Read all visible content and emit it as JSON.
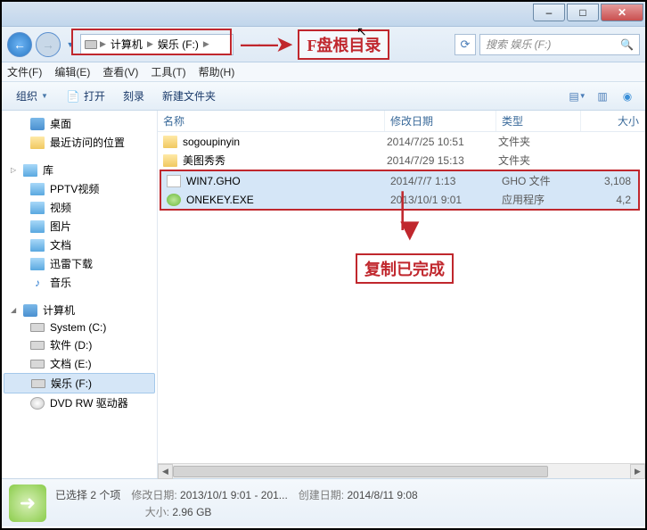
{
  "window": {
    "btn_min": "–",
    "btn_max": "□",
    "btn_close": "✕"
  },
  "address": {
    "computer": "计算机",
    "drive": "娱乐 (F:)",
    "annotation": "F盘根目录",
    "refresh": "⟳"
  },
  "search": {
    "placeholder": "搜索 娱乐 (F:)"
  },
  "menu": {
    "file": "文件(F)",
    "edit": "编辑(E)",
    "view": "查看(V)",
    "tools": "工具(T)",
    "help": "帮助(H)"
  },
  "toolbar": {
    "organize": "组织",
    "open": "打开",
    "burn": "刻录",
    "newfolder": "新建文件夹"
  },
  "nav": {
    "desktop": "桌面",
    "recent": "最近访问的位置",
    "library": "库",
    "pptv": "PPTV视频",
    "video": "视频",
    "pictures": "图片",
    "documents": "文档",
    "xunlei": "迅雷下载",
    "music": "音乐",
    "computer": "计算机",
    "sys_c": "System (C:)",
    "soft_d": "软件 (D:)",
    "doc_e": "文档 (E:)",
    "ent_f": "娱乐 (F:)",
    "dvd": "DVD RW 驱动器"
  },
  "columns": {
    "name": "名称",
    "date": "修改日期",
    "type": "类型",
    "size": "大小"
  },
  "files": [
    {
      "name": "sogoupinyin",
      "date": "2014/7/25 10:51",
      "type": "文件夹",
      "size": ""
    },
    {
      "name": "美图秀秀",
      "date": "2014/7/29 15:13",
      "type": "文件夹",
      "size": ""
    },
    {
      "name": "WIN7.GHO",
      "date": "2014/7/7 1:13",
      "type": "GHO 文件",
      "size": "3,108"
    },
    {
      "name": "ONEKEY.EXE",
      "date": "2013/10/1 9:01",
      "type": "应用程序",
      "size": "4,2"
    }
  ],
  "annotation2": "复制已完成",
  "status": {
    "selection": "已选择 2 个项",
    "mod_lbl": "修改日期:",
    "mod_val": "2013/10/1 9:01 - 201...",
    "crt_lbl": "创建日期:",
    "crt_val": "2014/8/11 9:08",
    "size_lbl": "大小:",
    "size_val": "2.96 GB"
  }
}
